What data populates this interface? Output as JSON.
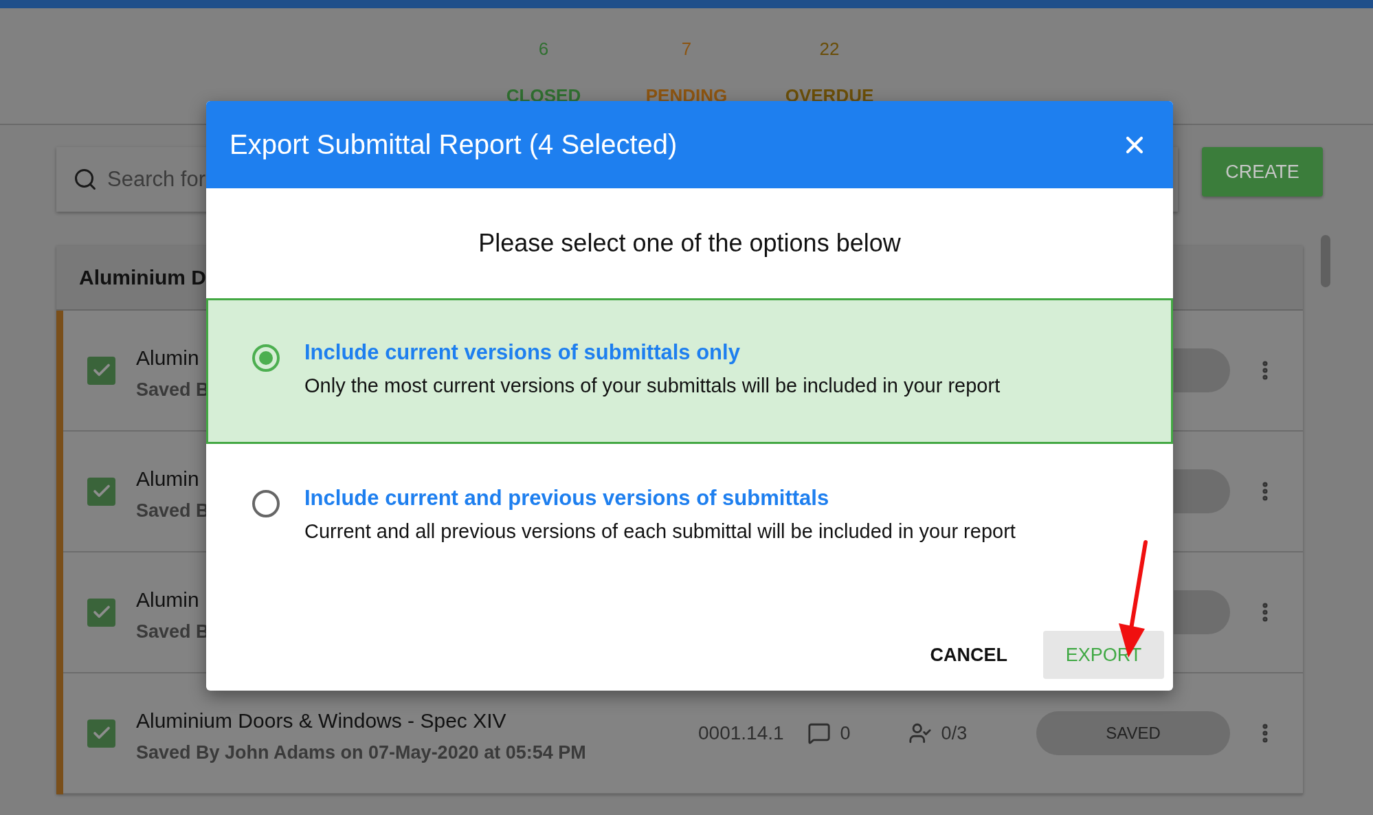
{
  "stats": [
    {
      "value": "6",
      "label": "CLOSED",
      "color": "#2f6f30"
    },
    {
      "value": "7",
      "label": "PENDING",
      "color": "#8c5410"
    },
    {
      "value": "22",
      "label": "OVERDUE",
      "color": "#6a4e08"
    }
  ],
  "search": {
    "placeholder": "Search for"
  },
  "create_button": "CREATE",
  "group": {
    "title": "Aluminium D",
    "rows": [
      {
        "title": "Alumin",
        "subtitle": "Saved B",
        "checked": true
      },
      {
        "title": "Alumin",
        "subtitle": "Saved B",
        "checked": true
      },
      {
        "title": "Alumin",
        "subtitle": "Saved B",
        "checked": true
      },
      {
        "title": "Aluminium Doors & Windows - Spec XIV",
        "subtitle": "Saved By John Adams on 07-May-2020 at 05:54 PM",
        "checked": true,
        "number": "0001.14.1",
        "comments": "0",
        "approvals": "0/3",
        "status": "SAVED"
      }
    ]
  },
  "dialog": {
    "title": "Export Submittal Report (4 Selected)",
    "prompt": "Please select one of the options below",
    "options": [
      {
        "title": "Include current versions of submittals only",
        "description": "Only the most current versions of your submittals will be included in your report",
        "selected": true
      },
      {
        "title": "Include current and previous versions of submittals",
        "description": "Current and all previous versions of each submittal will be included in your report",
        "selected": false
      }
    ],
    "buttons": [
      {
        "label": "CANCEL",
        "kind": "text"
      },
      {
        "label": "EXPORT",
        "kind": "primary"
      }
    ]
  }
}
